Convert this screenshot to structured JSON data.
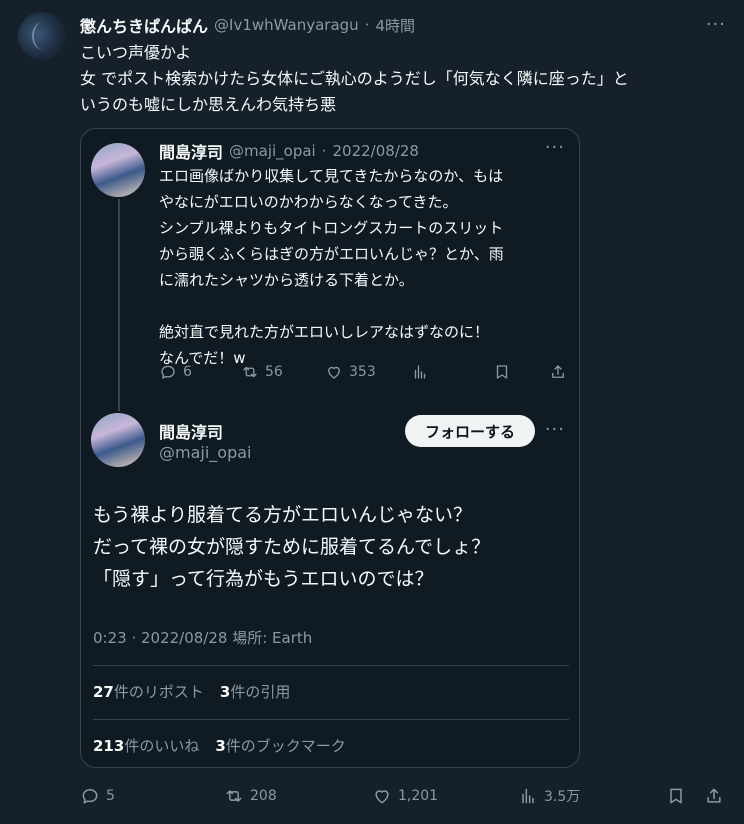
{
  "tweet": {
    "display_name": "懲んちきぱんぱん",
    "handle": "@Iv1whWanyaragu",
    "separator": "·",
    "time": "4時間",
    "more": "···",
    "text_lines": [
      "こいつ声優かよ",
      "女 でポスト検索かけたら女体にご執心のようだし「何気なく隣に座った」と",
      "いうのも嘘にしか思えんわ気持ち悪"
    ]
  },
  "quote": {
    "first": {
      "name": "間島淳司",
      "handle": "@maji_opai",
      "separator": "·",
      "date": "2022/08/28",
      "more": "···",
      "text_lines": [
        "エロ画像ばかり収集して見てきたからなのか、もは",
        "やなにがエロいのかわからなくなってきた。",
        "シンプル裸よりもタイトロングスカートのスリット",
        "から覗くふくらはぎの方がエロいんじゃ？とか、雨",
        "に濡れたシャツから透ける下着とか。",
        "",
        "絶対直で見れた方がエロいしレアなはずなのに！",
        "なんでだ！w"
      ],
      "replies": "6",
      "retweets": "56",
      "likes": "353"
    },
    "second": {
      "name": "間島淳司",
      "handle": "@maji_opai",
      "follow_label": "フォローする",
      "more": "···",
      "text_lines": [
        "もう裸より服着てる方がエロいんじゃない？",
        "だって裸の女が隠すために服着てるんでしょ？",
        "「隠す」って行為がもうエロいのでは？"
      ],
      "meta": "0:23 · 2022/08/28 場所: Earth",
      "reposts_count": "27",
      "reposts_label": "件のリポスト",
      "quotes_count": "3",
      "quotes_label": "件の引用",
      "likes_count": "213",
      "likes_label": "件のいいね",
      "bookmarks_count": "3",
      "bookmarks_label": "件のブックマーク"
    }
  },
  "actions": {
    "replies": "5",
    "retweets": "208",
    "likes": "1,201",
    "views": "3.5万"
  },
  "colors": {
    "background": "#15202b",
    "card": "#0f1a23",
    "border": "#38444d",
    "text": "#f7f9f9",
    "muted": "#8b98a5"
  }
}
